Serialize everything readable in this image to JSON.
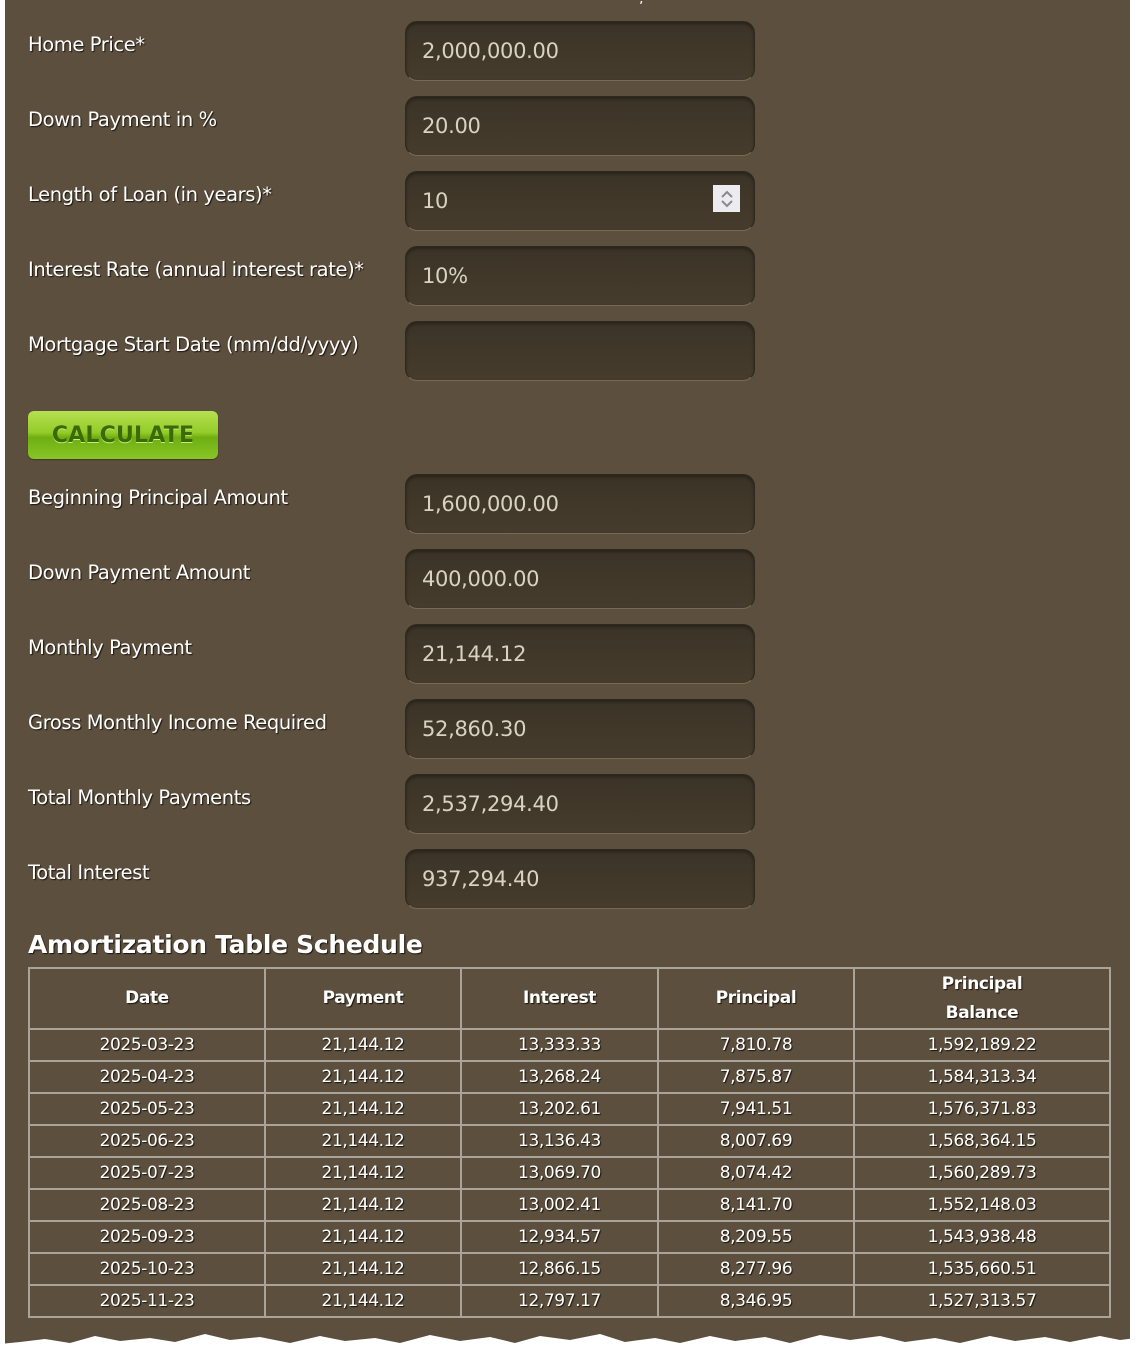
{
  "form": {
    "inputs": [
      {
        "label": "Home Price*",
        "value": "2,000,000.00",
        "type": "text"
      },
      {
        "label": "Down Payment in %",
        "value": "20.00",
        "type": "text"
      },
      {
        "label": "Length of Loan (in years)*",
        "value": "10",
        "type": "number"
      },
      {
        "label": "Interest Rate (annual interest rate)*",
        "value": "10%",
        "type": "text"
      },
      {
        "label": "Mortgage Start Date (mm/dd/yyyy)",
        "value": "",
        "type": "text"
      }
    ],
    "calculate_label": "CALCULATE"
  },
  "results": [
    {
      "label": "Beginning Principal Amount",
      "value": "1,600,000.00"
    },
    {
      "label": "Down Payment Amount",
      "value": "400,000.00"
    },
    {
      "label": "Monthly Payment",
      "value": "21,144.12"
    },
    {
      "label": "Gross Monthly Income Required",
      "value": "52,860.30"
    },
    {
      "label": "Total Monthly Payments",
      "value": "2,537,294.40"
    },
    {
      "label": "Total Interest",
      "value": "937,294.40"
    }
  ],
  "amortization": {
    "title": "Amortization Table Schedule",
    "columns": [
      "Date",
      "Payment",
      "Interest",
      "Principal",
      "Principal Balance"
    ],
    "rows": [
      [
        "2025-03-23",
        "21,144.12",
        "13,333.33",
        "7,810.78",
        "1,592,189.22"
      ],
      [
        "2025-04-23",
        "21,144.12",
        "13,268.24",
        "7,875.87",
        "1,584,313.34"
      ],
      [
        "2025-05-23",
        "21,144.12",
        "13,202.61",
        "7,941.51",
        "1,576,371.83"
      ],
      [
        "2025-06-23",
        "21,144.12",
        "13,136.43",
        "8,007.69",
        "1,568,364.15"
      ],
      [
        "2025-07-23",
        "21,144.12",
        "13,069.70",
        "8,074.42",
        "1,560,289.73"
      ],
      [
        "2025-08-23",
        "21,144.12",
        "13,002.41",
        "8,141.70",
        "1,552,148.03"
      ],
      [
        "2025-09-23",
        "21,144.12",
        "12,934.57",
        "8,209.55",
        "1,543,938.48"
      ],
      [
        "2025-10-23",
        "21,144.12",
        "12,866.15",
        "8,277.96",
        "1,535,660.51"
      ],
      [
        "2025-11-23",
        "21,144.12",
        "12,797.17",
        "8,346.95",
        "1,527,313.57"
      ]
    ]
  },
  "colors": {
    "page_bg": "#5c4f3e",
    "field_bg": "#3f3628",
    "button_green": "#8cc63f",
    "button_text": "#3d6a08"
  }
}
